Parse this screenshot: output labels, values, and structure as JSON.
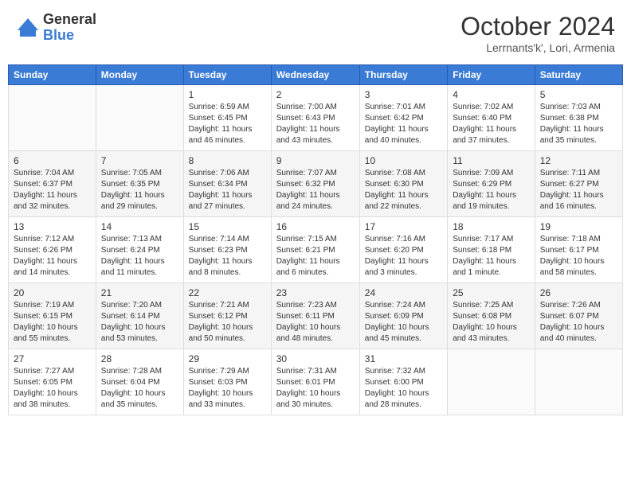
{
  "header": {
    "logo_general": "General",
    "logo_blue": "Blue",
    "month_title": "October 2024",
    "location": "Lerrnants'k', Lori, Armenia"
  },
  "weekdays": [
    "Sunday",
    "Monday",
    "Tuesday",
    "Wednesday",
    "Thursday",
    "Friday",
    "Saturday"
  ],
  "weeks": [
    [
      {
        "day": "",
        "sunrise": "",
        "sunset": "",
        "daylight": ""
      },
      {
        "day": "",
        "sunrise": "",
        "sunset": "",
        "daylight": ""
      },
      {
        "day": "1",
        "sunrise": "Sunrise: 6:59 AM",
        "sunset": "Sunset: 6:45 PM",
        "daylight": "Daylight: 11 hours and 46 minutes."
      },
      {
        "day": "2",
        "sunrise": "Sunrise: 7:00 AM",
        "sunset": "Sunset: 6:43 PM",
        "daylight": "Daylight: 11 hours and 43 minutes."
      },
      {
        "day": "3",
        "sunrise": "Sunrise: 7:01 AM",
        "sunset": "Sunset: 6:42 PM",
        "daylight": "Daylight: 11 hours and 40 minutes."
      },
      {
        "day": "4",
        "sunrise": "Sunrise: 7:02 AM",
        "sunset": "Sunset: 6:40 PM",
        "daylight": "Daylight: 11 hours and 37 minutes."
      },
      {
        "day": "5",
        "sunrise": "Sunrise: 7:03 AM",
        "sunset": "Sunset: 6:38 PM",
        "daylight": "Daylight: 11 hours and 35 minutes."
      }
    ],
    [
      {
        "day": "6",
        "sunrise": "Sunrise: 7:04 AM",
        "sunset": "Sunset: 6:37 PM",
        "daylight": "Daylight: 11 hours and 32 minutes."
      },
      {
        "day": "7",
        "sunrise": "Sunrise: 7:05 AM",
        "sunset": "Sunset: 6:35 PM",
        "daylight": "Daylight: 11 hours and 29 minutes."
      },
      {
        "day": "8",
        "sunrise": "Sunrise: 7:06 AM",
        "sunset": "Sunset: 6:34 PM",
        "daylight": "Daylight: 11 hours and 27 minutes."
      },
      {
        "day": "9",
        "sunrise": "Sunrise: 7:07 AM",
        "sunset": "Sunset: 6:32 PM",
        "daylight": "Daylight: 11 hours and 24 minutes."
      },
      {
        "day": "10",
        "sunrise": "Sunrise: 7:08 AM",
        "sunset": "Sunset: 6:30 PM",
        "daylight": "Daylight: 11 hours and 22 minutes."
      },
      {
        "day": "11",
        "sunrise": "Sunrise: 7:09 AM",
        "sunset": "Sunset: 6:29 PM",
        "daylight": "Daylight: 11 hours and 19 minutes."
      },
      {
        "day": "12",
        "sunrise": "Sunrise: 7:11 AM",
        "sunset": "Sunset: 6:27 PM",
        "daylight": "Daylight: 11 hours and 16 minutes."
      }
    ],
    [
      {
        "day": "13",
        "sunrise": "Sunrise: 7:12 AM",
        "sunset": "Sunset: 6:26 PM",
        "daylight": "Daylight: 11 hours and 14 minutes."
      },
      {
        "day": "14",
        "sunrise": "Sunrise: 7:13 AM",
        "sunset": "Sunset: 6:24 PM",
        "daylight": "Daylight: 11 hours and 11 minutes."
      },
      {
        "day": "15",
        "sunrise": "Sunrise: 7:14 AM",
        "sunset": "Sunset: 6:23 PM",
        "daylight": "Daylight: 11 hours and 8 minutes."
      },
      {
        "day": "16",
        "sunrise": "Sunrise: 7:15 AM",
        "sunset": "Sunset: 6:21 PM",
        "daylight": "Daylight: 11 hours and 6 minutes."
      },
      {
        "day": "17",
        "sunrise": "Sunrise: 7:16 AM",
        "sunset": "Sunset: 6:20 PM",
        "daylight": "Daylight: 11 hours and 3 minutes."
      },
      {
        "day": "18",
        "sunrise": "Sunrise: 7:17 AM",
        "sunset": "Sunset: 6:18 PM",
        "daylight": "Daylight: 11 hours and 1 minute."
      },
      {
        "day": "19",
        "sunrise": "Sunrise: 7:18 AM",
        "sunset": "Sunset: 6:17 PM",
        "daylight": "Daylight: 10 hours and 58 minutes."
      }
    ],
    [
      {
        "day": "20",
        "sunrise": "Sunrise: 7:19 AM",
        "sunset": "Sunset: 6:15 PM",
        "daylight": "Daylight: 10 hours and 55 minutes."
      },
      {
        "day": "21",
        "sunrise": "Sunrise: 7:20 AM",
        "sunset": "Sunset: 6:14 PM",
        "daylight": "Daylight: 10 hours and 53 minutes."
      },
      {
        "day": "22",
        "sunrise": "Sunrise: 7:21 AM",
        "sunset": "Sunset: 6:12 PM",
        "daylight": "Daylight: 10 hours and 50 minutes."
      },
      {
        "day": "23",
        "sunrise": "Sunrise: 7:23 AM",
        "sunset": "Sunset: 6:11 PM",
        "daylight": "Daylight: 10 hours and 48 minutes."
      },
      {
        "day": "24",
        "sunrise": "Sunrise: 7:24 AM",
        "sunset": "Sunset: 6:09 PM",
        "daylight": "Daylight: 10 hours and 45 minutes."
      },
      {
        "day": "25",
        "sunrise": "Sunrise: 7:25 AM",
        "sunset": "Sunset: 6:08 PM",
        "daylight": "Daylight: 10 hours and 43 minutes."
      },
      {
        "day": "26",
        "sunrise": "Sunrise: 7:26 AM",
        "sunset": "Sunset: 6:07 PM",
        "daylight": "Daylight: 10 hours and 40 minutes."
      }
    ],
    [
      {
        "day": "27",
        "sunrise": "Sunrise: 7:27 AM",
        "sunset": "Sunset: 6:05 PM",
        "daylight": "Daylight: 10 hours and 38 minutes."
      },
      {
        "day": "28",
        "sunrise": "Sunrise: 7:28 AM",
        "sunset": "Sunset: 6:04 PM",
        "daylight": "Daylight: 10 hours and 35 minutes."
      },
      {
        "day": "29",
        "sunrise": "Sunrise: 7:29 AM",
        "sunset": "Sunset: 6:03 PM",
        "daylight": "Daylight: 10 hours and 33 minutes."
      },
      {
        "day": "30",
        "sunrise": "Sunrise: 7:31 AM",
        "sunset": "Sunset: 6:01 PM",
        "daylight": "Daylight: 10 hours and 30 minutes."
      },
      {
        "day": "31",
        "sunrise": "Sunrise: 7:32 AM",
        "sunset": "Sunset: 6:00 PM",
        "daylight": "Daylight: 10 hours and 28 minutes."
      },
      {
        "day": "",
        "sunrise": "",
        "sunset": "",
        "daylight": ""
      },
      {
        "day": "",
        "sunrise": "",
        "sunset": "",
        "daylight": ""
      }
    ]
  ]
}
